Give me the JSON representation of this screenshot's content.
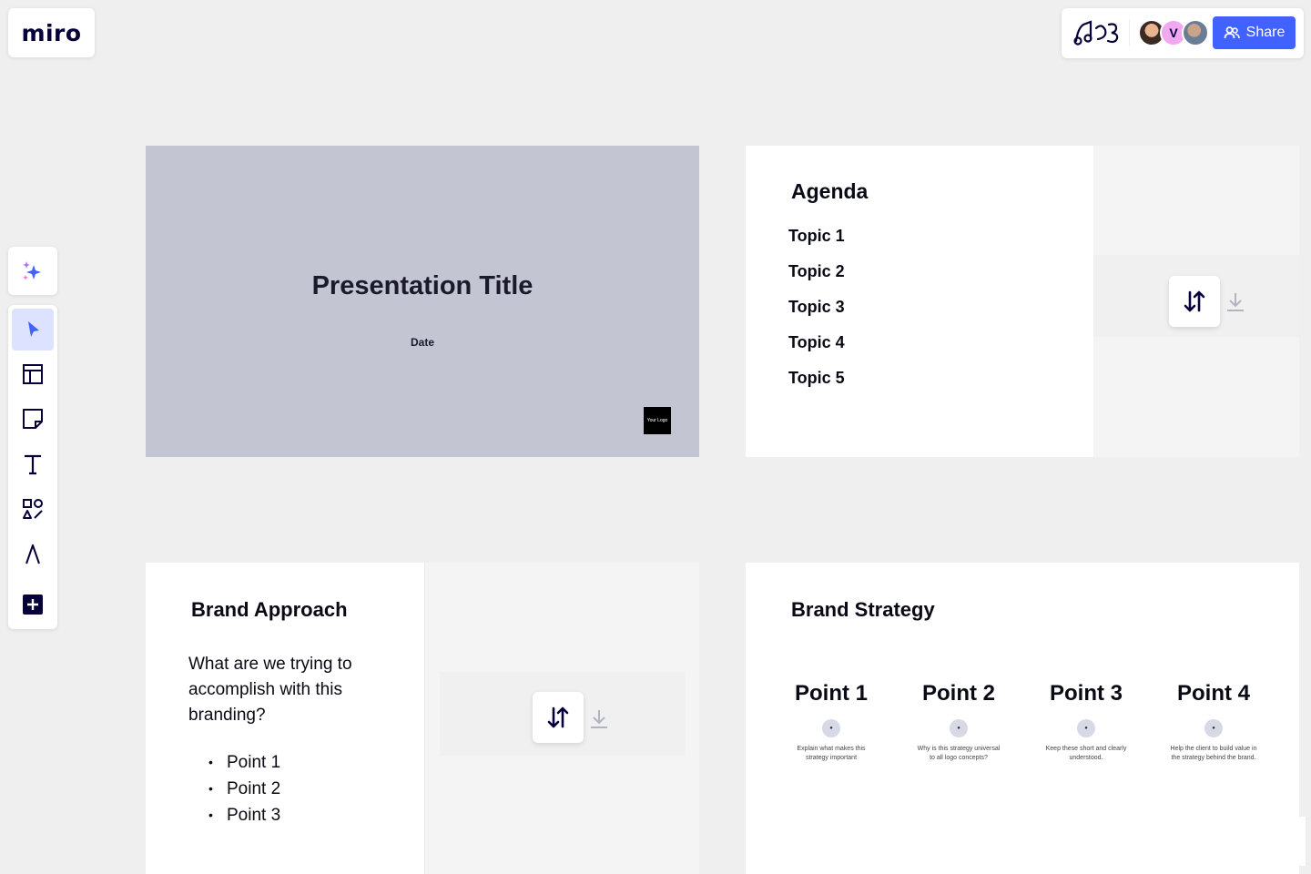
{
  "app": {
    "logo": "miro"
  },
  "header": {
    "collaborators": [
      {
        "name": "avatar-1"
      },
      {
        "initial": "V"
      },
      {
        "name": "avatar-3"
      }
    ],
    "share_label": "Share"
  },
  "toolbar": {
    "tools": [
      {
        "name": "select-tool",
        "icon": "cursor-icon",
        "active": true
      },
      {
        "name": "templates-tool",
        "icon": "layout-icon"
      },
      {
        "name": "sticky-note-tool",
        "icon": "sticky-note-icon"
      },
      {
        "name": "text-tool",
        "icon": "text-icon"
      },
      {
        "name": "shapes-tool",
        "icon": "shapes-icon"
      },
      {
        "name": "pen-tool",
        "icon": "pen-icon"
      },
      {
        "name": "more-tools",
        "icon": "plus-square-icon"
      }
    ]
  },
  "frames": {
    "title_slide": {
      "title": "Presentation Title",
      "date": "Date",
      "logo_placeholder": "Your Logo",
      "bg": "#c3c5d3"
    },
    "agenda": {
      "heading": "Agenda",
      "topics": [
        "Topic 1",
        "Topic 2",
        "Topic 3",
        "Topic 4",
        "Topic 5"
      ]
    },
    "brand_approach": {
      "heading": "Brand Approach",
      "question": "What are we trying to accomplish with this branding?",
      "points": [
        "Point 1",
        "Point 2",
        "Point 3"
      ]
    },
    "brand_strategy": {
      "heading": "Brand Strategy",
      "points": [
        {
          "title": "Point 1",
          "desc": "Explain what makes this strategy important"
        },
        {
          "title": "Point 2",
          "desc": "Why is this strategy universal to all logo concepts?"
        },
        {
          "title": "Point 3",
          "desc": "Keep these short and clearly understood."
        },
        {
          "title": "Point 4",
          "desc": "Help the client to build value in the strategy behind the brand."
        }
      ]
    }
  },
  "colors": {
    "accent": "#4262ff",
    "canvas": "#efefef",
    "active_tool_bg": "#dde3ff"
  }
}
